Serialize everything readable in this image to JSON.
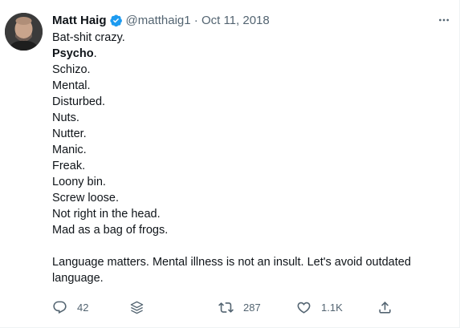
{
  "author": {
    "name": "Matt Haig",
    "handle": "@matthaig1",
    "separator": "·",
    "date": "Oct 11, 2018"
  },
  "tweet": {
    "lines": [
      {
        "pre": "Bat-shit crazy.",
        "bold": "",
        "post": ""
      },
      {
        "pre": "",
        "bold": "Psycho",
        "post": "."
      },
      {
        "pre": "Schizo.",
        "bold": "",
        "post": ""
      },
      {
        "pre": "Mental.",
        "bold": "",
        "post": ""
      },
      {
        "pre": "Disturbed.",
        "bold": "",
        "post": ""
      },
      {
        "pre": "Nuts.",
        "bold": "",
        "post": ""
      },
      {
        "pre": "Nutter.",
        "bold": "",
        "post": ""
      },
      {
        "pre": "Manic.",
        "bold": "",
        "post": ""
      },
      {
        "pre": "Freak.",
        "bold": "",
        "post": ""
      },
      {
        "pre": "Loony bin.",
        "bold": "",
        "post": ""
      },
      {
        "pre": "Screw loose.",
        "bold": "",
        "post": ""
      },
      {
        "pre": "Not right in the head.",
        "bold": "",
        "post": ""
      },
      {
        "pre": "Mad as a bag of frogs.",
        "bold": "",
        "post": ""
      }
    ],
    "closing": "Language matters. Mental illness is not an insult. Let's avoid outdated language."
  },
  "actions": {
    "replies": "42",
    "retweets": "287",
    "likes": "1.1K"
  },
  "icons": {
    "verified": "verified-badge-icon",
    "more": "more-options-icon",
    "reply": "reply-icon",
    "layers": "layers-icon",
    "retweet": "retweet-icon",
    "like": "heart-icon",
    "share": "share-icon"
  },
  "colors": {
    "verified_blue": "#1d9bf0",
    "secondary_text": "#536471",
    "primary_text": "#0f1419"
  }
}
